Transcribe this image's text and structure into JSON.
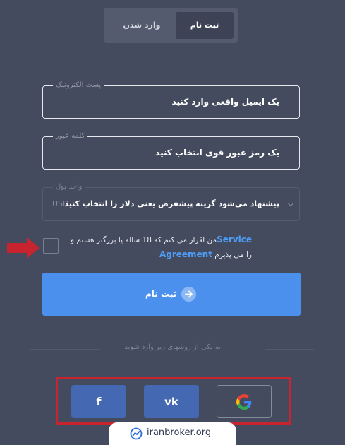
{
  "tabs": {
    "register": "ثبت نام",
    "login": "وارد شدن"
  },
  "form": {
    "email": {
      "label": "پست الکترونیک",
      "placeholder": "یک ایمیل واقعی وارد کنید"
    },
    "password": {
      "label": "کلمه عبور",
      "placeholder": "یک رمز عبور قوی انتخاب کنید"
    },
    "currency": {
      "label": "واحد پول",
      "hint": "پیشنهاد می‌شود گزینه پیشفرض یعنی دلار را انتخاب کنید",
      "code": "USD"
    },
    "agreement": {
      "link1": "Service",
      "text1": "من اقرار می کنم که 18 ساله یا بزرگتر هستم و",
      "link2": "Agreement",
      "text2": "را می پذیرم"
    },
    "submit": "ثبت نام"
  },
  "social": {
    "divider": "به یکی از روشهای زیر وارد شوید",
    "facebook": "f",
    "vk": "vk"
  },
  "watermark": {
    "text": "iranbroker.org"
  },
  "colors": {
    "background": "#454b5f",
    "primary": "#4c90ed",
    "social": "#4468b2",
    "highlight": "#c8242f"
  }
}
